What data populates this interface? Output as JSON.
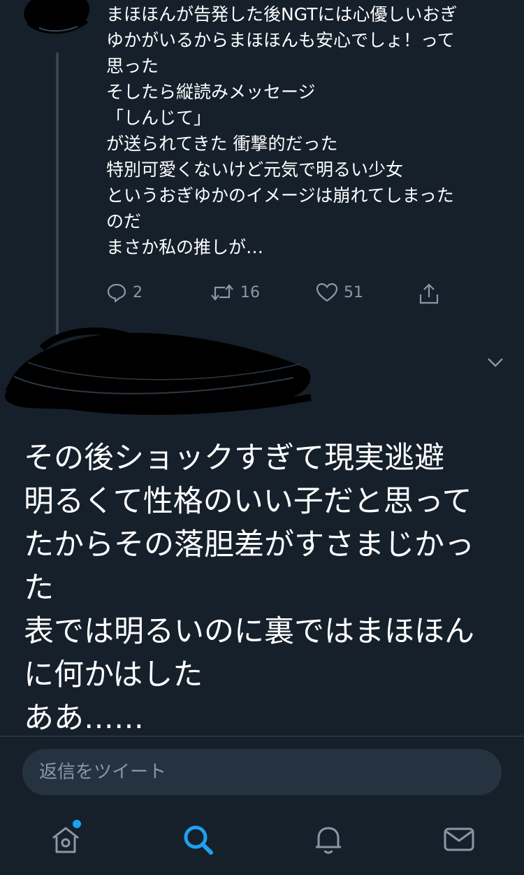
{
  "previous_tweet": {
    "lines": [
      "まほほんが告発した後NGTには心優しいおぎ",
      "ゆかがいるからまほほんも安心でしょ！って",
      "思った",
      "そしたら縦読みメッセージ",
      "「しんじて」",
      "が送られてきた  衝撃的だった",
      "特別可愛くないけど元気で明るい少女",
      "というおぎゆかのイメージは崩れてしまった",
      "のだ",
      "まさか私の推しが…"
    ],
    "reply_count": "2",
    "retweet_count": "16",
    "like_count": "51"
  },
  "main_tweet": {
    "lines": [
      "その後ショックすぎて現実逃避",
      "明るくて性格のいい子だと思って",
      "たからその落胆差がすさまじかっ",
      "た",
      "表では明るいのに裏ではまほほん",
      "に何かはした",
      "ああ……"
    ]
  },
  "reply_bar": {
    "placeholder": "返信をツイート"
  },
  "nav": {
    "items": [
      "home-icon",
      "search-icon",
      "notifications-icon",
      "messages-icon"
    ],
    "active": "search-icon",
    "accent_color": "#1da1f2",
    "icon_color": "#8899a6"
  },
  "colors": {
    "background": "#15202b",
    "secondary_text": "#8899a6",
    "divider": "#38444d"
  }
}
